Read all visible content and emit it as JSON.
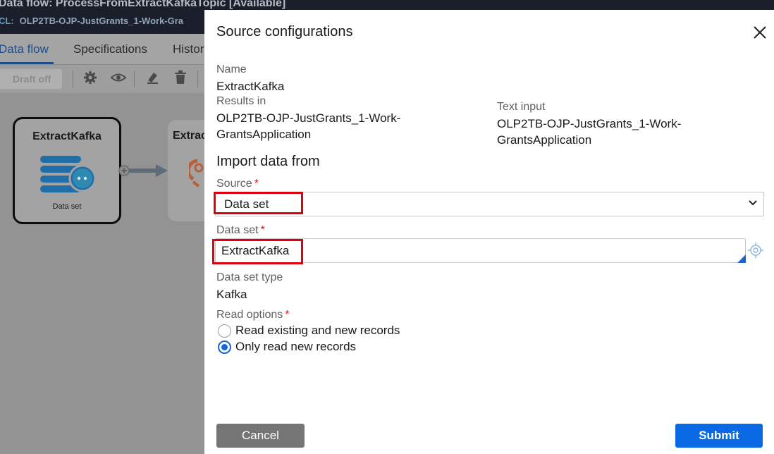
{
  "background": {
    "window_title": "Data flow: ProcessFromExtractKafkaTopic [Available]",
    "class_label": "CL:",
    "class_value": "OLP2TB-OJP-JustGrants_1-Work-Gra",
    "tabs": [
      {
        "label": "Data flow",
        "active": true
      },
      {
        "label": "Specifications",
        "active": false
      },
      {
        "label": "Histor",
        "active": false
      }
    ],
    "toolbar": {
      "draft_label": "Draft off",
      "icons": [
        "gear-icon",
        "eye-icon",
        "eraser-icon",
        "trash-icon"
      ]
    },
    "canvas": {
      "node1_title": "ExtractKafka",
      "node1_subtitle": "Data set",
      "node2_title": "Extrac"
    }
  },
  "modal": {
    "title": "Source configurations",
    "name_label": "Name",
    "name_value": "ExtractKafka",
    "results_in_label": "Results in",
    "results_in_value": "OLP2TB-OJP-JustGrants_1-Work-GrantsApplication",
    "text_input_label": "Text input",
    "text_input_value": "OLP2TB-OJP-JustGrants_1-Work-GrantsApplication",
    "section_title": "Import data from",
    "source_label": "Source",
    "source_value": "Data set",
    "dataset_label": "Data set",
    "dataset_value": "ExtractKafka",
    "dataset_type_label": "Data set type",
    "dataset_type_value": "Kafka",
    "read_options_label": "Read options",
    "read_options": [
      {
        "label": "Read existing and new records",
        "checked": false
      },
      {
        "label": "Only read new records",
        "checked": true
      }
    ],
    "required_marker": "*",
    "cancel_label": "Cancel",
    "submit_label": "Submit"
  },
  "colors": {
    "accent": "#0a6ae6",
    "required": "#c0202a",
    "highlight_box": "#e0000d",
    "cancel_button": "#757575"
  }
}
